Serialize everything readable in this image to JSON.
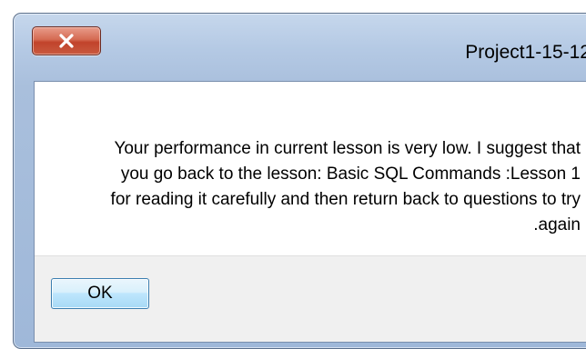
{
  "window": {
    "title": "Project1-15-12"
  },
  "titlebar": {
    "close_icon": "close-x-icon"
  },
  "message": {
    "lines": [
      "Your performance in current lesson is very low. I suggest that",
      "you go back to the lesson: Basic SQL Commands :Lesson 1",
      "for reading it carefully and then return back to questions to try",
      ".again"
    ]
  },
  "footer": {
    "ok_label": "OK"
  },
  "colors": {
    "titlebar": "#b4c9e4",
    "close_button": "#c1432b",
    "ok_button": "#bee6fd",
    "footer": "#f0f0f0"
  }
}
